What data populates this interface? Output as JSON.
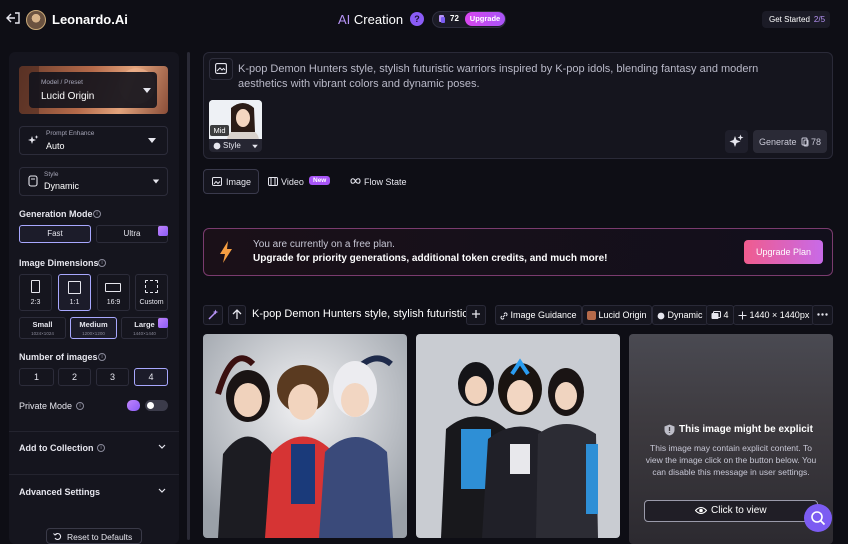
{
  "header": {
    "brand": "Leonardo.Ai",
    "title_ai": "AI",
    "title_rest": " Creation",
    "help_icon": "?",
    "tokens": "72",
    "upgrade": "Upgrade",
    "get_started": "Get Started",
    "get_started_progress": "2/5"
  },
  "sidebar": {
    "model_label": "Model / Preset",
    "model_value": "Lucid Origin",
    "prompt_enhance_label": "Prompt Enhance",
    "prompt_enhance_value": "Auto",
    "style_label": "Style",
    "style_value": "Dynamic",
    "generation_mode_title": "Generation Mode",
    "generation_modes": [
      "Fast",
      "Ultra"
    ],
    "selected_generation_mode": "Fast",
    "image_dimensions_title": "Image Dimensions",
    "aspect_ratios": [
      "2:3",
      "1:1",
      "16:9",
      "Custom"
    ],
    "selected_aspect_ratio": "1:1",
    "sizes": [
      {
        "label": "Small",
        "dims": "1024×1024"
      },
      {
        "label": "Medium",
        "dims": "1200×1200"
      },
      {
        "label": "Large",
        "dims": "1440×1440"
      }
    ],
    "selected_size": "Medium",
    "number_of_images_title": "Number of images",
    "image_counts": [
      "1",
      "2",
      "3",
      "4"
    ],
    "selected_image_count": "4",
    "private_mode_title": "Private Mode",
    "private_mode_on": false,
    "add_to_collection": "Add to Collection",
    "advanced_settings": "Advanced Settings",
    "reset": "Reset to Defaults"
  },
  "prompt": {
    "text": "K-pop Demon Hunters style, stylish futuristic warriors inspired by K-pop idols, blending fantasy and modern aesthetics with vibrant colors and dynamic poses.",
    "style_tag": "Mid",
    "style_label": "Style",
    "generate_label": "Generate",
    "generate_cost": "78"
  },
  "tabs": [
    {
      "label": "Image",
      "selected": true
    },
    {
      "label": "Video",
      "badge": "New"
    },
    {
      "label": "Flow State"
    }
  ],
  "banner": {
    "line1": "You are currently on a free plan.",
    "line2": "Upgrade for priority generations, additional token credits, and much more!",
    "button": "Upgrade Plan"
  },
  "generation": {
    "prompt_truncated": "K-pop Demon Hunters style, stylish futuristic...",
    "image_guidance": "Image Guidance",
    "model": "Lucid Origin",
    "style": "Dynamic",
    "count": "4",
    "dimensions": "1440 × 1440px"
  },
  "explicit": {
    "title": "This image might be explicit",
    "body": "This image may contain explicit content. To view the image click on the button below. You can disable this message in user settings.",
    "button": "Click to view"
  },
  "colors": {
    "accent": "#8b5cf6",
    "upgrade_gradient_start": "#f05c8e",
    "upgrade_gradient_end": "#c86ae8",
    "background": "#0e0e15"
  }
}
